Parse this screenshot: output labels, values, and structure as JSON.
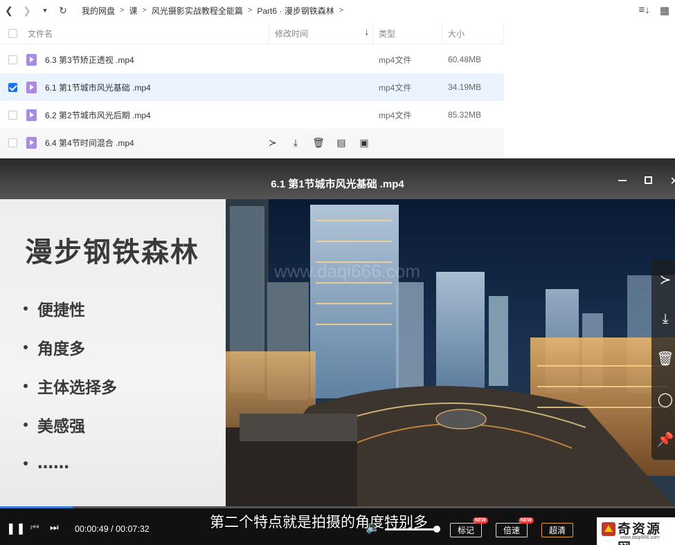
{
  "toolbar": {
    "breadcrumbs": [
      "我的网盘",
      "课",
      "风光摄影实战教程全能篇",
      "Part6 · 漫步钢铁森林"
    ]
  },
  "table": {
    "headers": {
      "name": "文件名",
      "modified": "修改时间",
      "type": "类型",
      "size": "大小"
    },
    "rows": [
      {
        "name": "6.3 第3节矫正透视 .mp4",
        "type": "mp4文件",
        "size": "60.48MB",
        "selected": false
      },
      {
        "name": "6.1 第1节城市风光基础 .mp4",
        "type": "mp4文件",
        "size": "34.19MB",
        "selected": true
      },
      {
        "name": "6.2 第2节城市风光后期 .mp4",
        "type": "mp4文件",
        "size": "85.32MB",
        "selected": false
      },
      {
        "name": "6.4 第4节时间混合 .mp4",
        "type": "",
        "size": "",
        "selected": false
      }
    ],
    "row_action_icons": [
      "share-icon",
      "download-icon",
      "delete-icon",
      "rename-icon",
      "more-icon"
    ]
  },
  "player": {
    "title": "6.1 第1节城市风光基础 .mp4",
    "slide": {
      "title": "漫步钢铁森林",
      "bullets": [
        "便捷性",
        "角度多",
        "主体选择多",
        "美感强",
        "……"
      ]
    },
    "watermark": "www.daqi666.com",
    "subtitle": "第二个特点就是拍摄的角度特别多",
    "time": "00:00:49 / 00:07:32",
    "progress": 0.108,
    "volume": 1.0,
    "buttons": {
      "mark": "标记",
      "speed": "倍速",
      "quality": "超清"
    },
    "badge": "NEW",
    "side_tools": [
      "share-icon",
      "download-icon",
      "delete-icon",
      "settings-icon",
      "pin-icon"
    ]
  },
  "logo": {
    "text": "奇资源网",
    "url": "www.daqi666.com"
  },
  "colors": {
    "accent": "#1a73e8",
    "selected_row": "#eaf3fe",
    "quality_border": "#e6a23c"
  }
}
